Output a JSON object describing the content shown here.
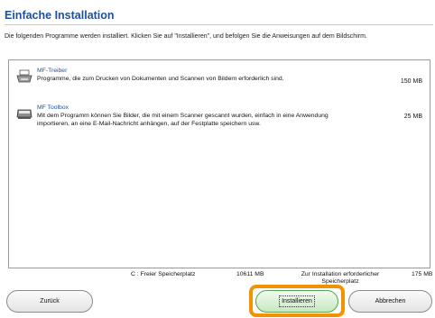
{
  "header": {
    "title": "Einfache Installation",
    "instruction": "Die folgenden Programme werden installiert. Klicken Sie auf \"Installieren\", und befolgen Sie die Anweisungen auf dem Bildschirm."
  },
  "programs": [
    {
      "name": "MF-Treiber",
      "description": "Programme, die zum Drucken von Dokumenten und Scannen von Bildern erforderlich sind.",
      "size": "150 MB",
      "icon": "printer-icon"
    },
    {
      "name": "MF Toolbox",
      "description": "Mit dem Programm können Sie Bilder, die mit einem Scanner gescannt wurden, einfach in eine Anwendung importieren, an eine E-Mail-Nachricht anhängen, auf der Festplatte speichern usw.",
      "size": "25 MB",
      "icon": "scanner-icon"
    }
  ],
  "status": {
    "free_space_label": "C : Freier Speicherplatz",
    "free_space_value": "10611 MB",
    "required_label": "Zur Installation erforderlicher Speicherplatz",
    "required_value": "175 MB"
  },
  "buttons": {
    "back": "Zurück",
    "install": "Installieren",
    "cancel": "Abbrechen"
  },
  "colors": {
    "title": "#1f4f9a",
    "highlight": "#f39200",
    "install_button": "#c7e8c0"
  }
}
